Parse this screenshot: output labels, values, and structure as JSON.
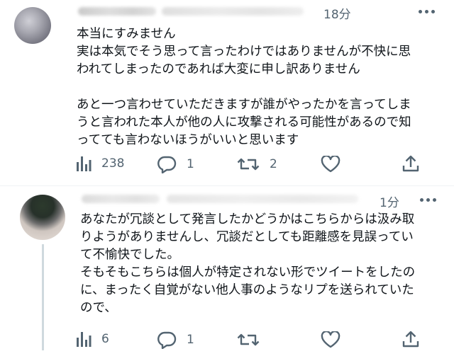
{
  "tweets": [
    {
      "time": "18分",
      "body_lines": [
        "本当にすみません",
        "実は本気でそう思って言ったわけではありませんが不快に思",
        "われてしまったのであれば大変に申し訳ありません",
        "",
        "あと一つ言わせていただきますが誰がやったかを言ってしま",
        "うと言われた本人が他の人に攻撃される可能性があるので知",
        "ってても言わないほうがいいと思います"
      ],
      "views": "238",
      "replies": "1",
      "retweets": "2",
      "likes": ""
    },
    {
      "time": "1分",
      "body_lines": [
        "あなたが冗談として発言したかどうかはこちらからは汲み取",
        "りようがありませんし、冗談だとしても距離感を見誤ってい",
        "て不愉快でした。",
        "そもそもこちらは個人が特定されない形でツイートをしたの",
        "に、まったく自覚がない他人事のようなリプを送られていた",
        "ので、"
      ],
      "views": "6",
      "replies": "1",
      "retweets": "",
      "likes": ""
    }
  ],
  "icons": {
    "views": "bar-chart-icon",
    "reply": "speech-bubble-icon",
    "retweet": "retweet-arrows-icon",
    "like": "heart-icon",
    "share": "share-upload-icon",
    "more": "more-dots-icon"
  },
  "colors": {
    "text": "#0f1419",
    "secondary": "#536471",
    "divider": "#eff3f4",
    "thread": "#cfd9de"
  }
}
